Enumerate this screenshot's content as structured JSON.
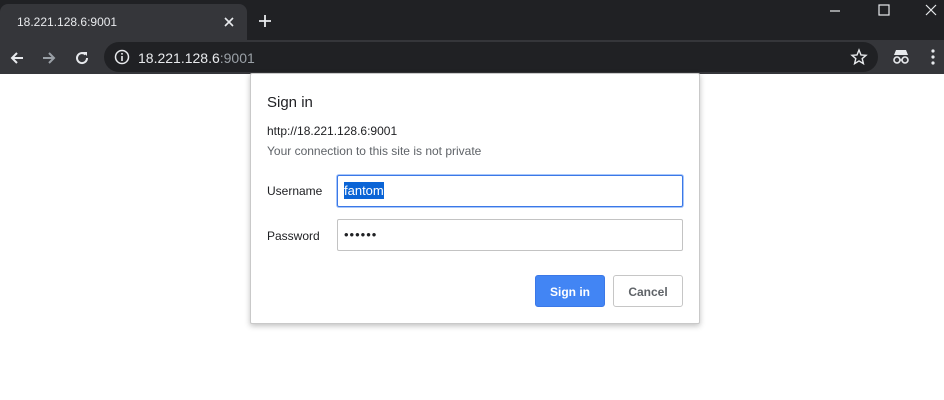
{
  "tab": {
    "title": "18.221.128.6:9001"
  },
  "address_bar": {
    "host": "18.221.128.6",
    "port": ":9001"
  },
  "dialog": {
    "title": "Sign in",
    "origin": "http://18.221.128.6:9001",
    "warning": "Your connection to this site is not private",
    "username_label": "Username",
    "username_value": "fantom",
    "password_label": "Password",
    "password_mask": "••••••",
    "sign_in_label": "Sign in",
    "cancel_label": "Cancel"
  },
  "colors": {
    "chrome_dark": "#202124",
    "toolbar": "#35363a",
    "primary_button": "#4285f4",
    "selection": "#0a64d6"
  },
  "icons": [
    "close-icon",
    "new-tab-icon",
    "minimize-icon",
    "maximize-icon",
    "window-close-icon",
    "back-icon",
    "forward-icon",
    "reload-icon",
    "info-icon",
    "star-icon",
    "incognito-icon",
    "menu-icon"
  ]
}
